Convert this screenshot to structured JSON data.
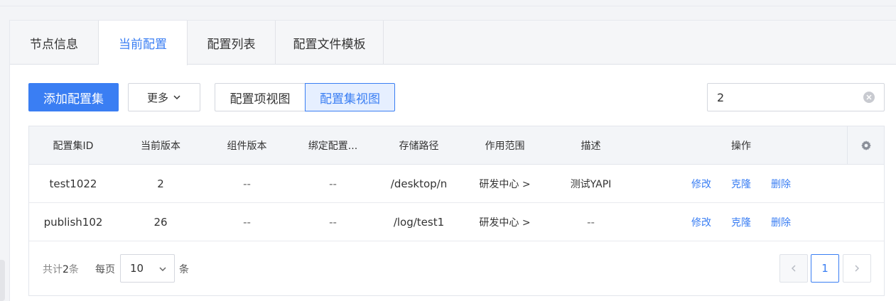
{
  "tabs": [
    {
      "label": "节点信息"
    },
    {
      "label": "当前配置"
    },
    {
      "label": "配置列表"
    },
    {
      "label": "配置文件模板"
    }
  ],
  "toolbar": {
    "add_label": "添加配置集",
    "more_label": "更多",
    "view_item_label": "配置项视图",
    "view_set_label": "配置集视图"
  },
  "search": {
    "value": "2"
  },
  "table": {
    "headers": [
      "配置集ID",
      "当前版本",
      "组件版本",
      "绑定配置...",
      "存储路径",
      "作用范围",
      "描述",
      "操作"
    ],
    "rows": [
      {
        "id": "test1022",
        "version": "2",
        "component_version": "--",
        "bound": "--",
        "path": "/desktop/n",
        "scope": "研发中心 >",
        "desc": "测试YAPI"
      },
      {
        "id": "publish102",
        "version": "26",
        "component_version": "--",
        "bound": "--",
        "path": "/log/test1",
        "scope": "研发中心 >",
        "desc": "--"
      }
    ],
    "actions": {
      "edit": "修改",
      "clone": "克隆",
      "delete": "删除"
    }
  },
  "pagination": {
    "total_prefix": "共计",
    "total_count": "2",
    "total_suffix": "条",
    "per_page_label": "每页",
    "page_size": "10",
    "unit_label": "条",
    "current_page": "1"
  },
  "colors": {
    "accent": "#3a7ef3"
  }
}
